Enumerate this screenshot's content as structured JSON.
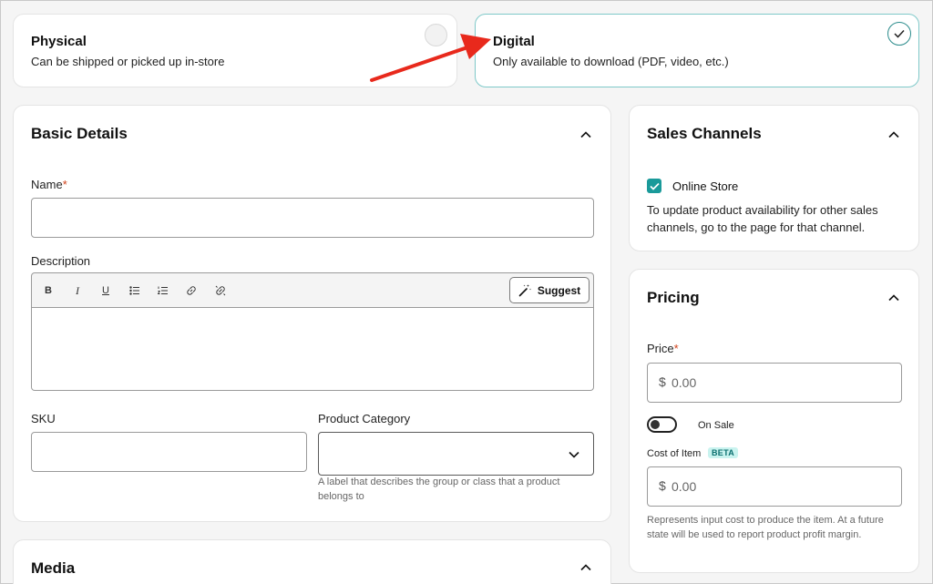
{
  "product_type": {
    "physical": {
      "title": "Physical",
      "description": "Can be shipped or picked up in-store",
      "selected": false
    },
    "digital": {
      "title": "Digital",
      "description": "Only available to download (PDF, video, etc.)",
      "selected": true
    }
  },
  "basic_details": {
    "title": "Basic Details",
    "name_label": "Name",
    "required_mark": "*",
    "name_value": "",
    "description_label": "Description",
    "toolbar": {
      "icons": [
        "bold-icon",
        "italic-icon",
        "underline-icon",
        "bullet-list-icon",
        "numbered-list-icon",
        "link-icon",
        "unlink-icon"
      ],
      "suggest_label": "Suggest"
    },
    "sku_label": "SKU",
    "sku_value": "",
    "category_label": "Product Category",
    "category_value": "",
    "category_helper": "A label that describes the group or class that a product belongs to"
  },
  "media": {
    "title": "Media"
  },
  "sales_channels": {
    "title": "Sales Channels",
    "online_store_label": "Online Store",
    "online_store_checked": true,
    "info_text": "To update product availability for other sales channels, go to the page for that channel."
  },
  "pricing": {
    "title": "Pricing",
    "price_label": "Price",
    "required_mark": "*",
    "currency_symbol": "$",
    "price_placeholder": "0.00",
    "on_sale_label": "On Sale",
    "on_sale": false,
    "cost_label": "Cost of Item",
    "beta_badge": "BETA",
    "cost_placeholder": "0.00",
    "cost_helper": "Represents input cost to produce the item. At a future state will be used to report product profit margin."
  },
  "colors": {
    "accent": "#1a9a9a",
    "selected_border": "#7fc9c9",
    "arrow": "#e8291c",
    "required": "#d0421b"
  }
}
